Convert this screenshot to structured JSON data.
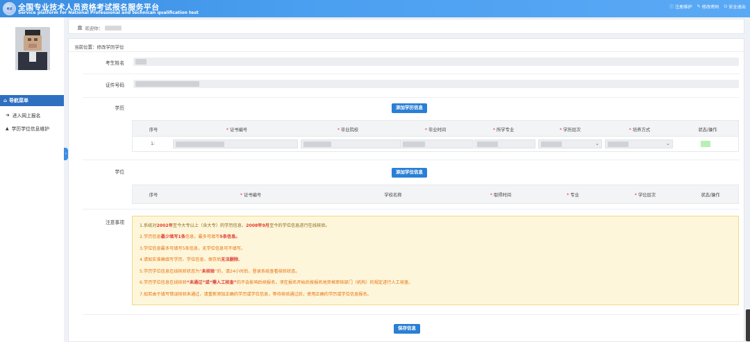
{
  "header": {
    "logo_text": "考试",
    "title_cn": "全国专业技术人员资格考试报名服务平台",
    "title_en": "Service platform for National Professional and technican qualification test",
    "links": [
      {
        "icon": "info-circle-icon",
        "glyph": "ⓘ",
        "label": "注册维护"
      },
      {
        "icon": "edit-icon",
        "glyph": "✎",
        "label": "修改密码"
      },
      {
        "icon": "power-icon",
        "glyph": "⏻",
        "label": "安全退出"
      }
    ]
  },
  "sidebar": {
    "nav_title": "导航菜单",
    "items": [
      {
        "icon": "sign-in-icon",
        "glyph": "➜",
        "label": "进入网上报名"
      },
      {
        "icon": "graduation-cap-icon",
        "glyph": "🎓",
        "label": "学历学位信息维护"
      }
    ]
  },
  "welcome": {
    "text": "欢迎你："
  },
  "breadcrumb": "当前位置：修改学历学位",
  "form": {
    "name_label": "考生姓名",
    "id_label": "证件号码",
    "education_label": "学历",
    "add_education_btn": "添加学历信息",
    "degree_label": "学位",
    "add_degree_btn": "添加学位信息",
    "notice_label": "注意事项",
    "save_btn": "保存信息"
  },
  "education_table": {
    "columns": [
      "序号",
      "证书编号",
      "毕业院校",
      "毕业时间",
      "所学专业",
      "学历层次",
      "培养方式",
      "状态/操作"
    ],
    "required": [
      false,
      true,
      true,
      true,
      true,
      true,
      true,
      false
    ],
    "rows": [
      {
        "index": "1:"
      }
    ]
  },
  "degree_table": {
    "columns": [
      "序号",
      "证书编号",
      "学校名称",
      "取得时间",
      "专业",
      "学位层次",
      "状态/操作"
    ],
    "required": [
      false,
      true,
      false,
      true,
      true,
      true,
      false
    ]
  },
  "notice": {
    "line1": {
      "a": "1.系统对",
      "b": "2002年",
      "c": "至今大专以上（含大专）的学历信息、",
      "d": "2008年9月",
      "e": "至今的学位信息进行在线核验。"
    },
    "line2": {
      "a": "2.学历信息",
      "b": "最少填写1条",
      "c": "信息，最多可填写",
      "d": "5条信息。"
    },
    "line3": "3.学位信息最多可填写5条信息，无学位信息可不填写。",
    "line4": {
      "a": "4.请如实准确填写学历、学位信息，保存后",
      "b": "无法删除",
      "c": "。"
    },
    "line5": {
      "a": "5.学历学位信息在线核验状态为“",
      "b": "未核验",
      "c": "”的，请24小时后，登录系统查看核验状态。"
    },
    "line6": {
      "a": "6.学历学位信息在线核验",
      "b": "“未通过”或“需人工核查”",
      "c": "的不会影响后续报名，须在报名开始后按报名地资格审核部门（机构）的规定进行人工核查。"
    },
    "line7": "7.如若由于填写错误核验未通过，请重新添加正确的学历或学位信息，等待核验通过后，使用正确的学历或学位信息报名。"
  }
}
